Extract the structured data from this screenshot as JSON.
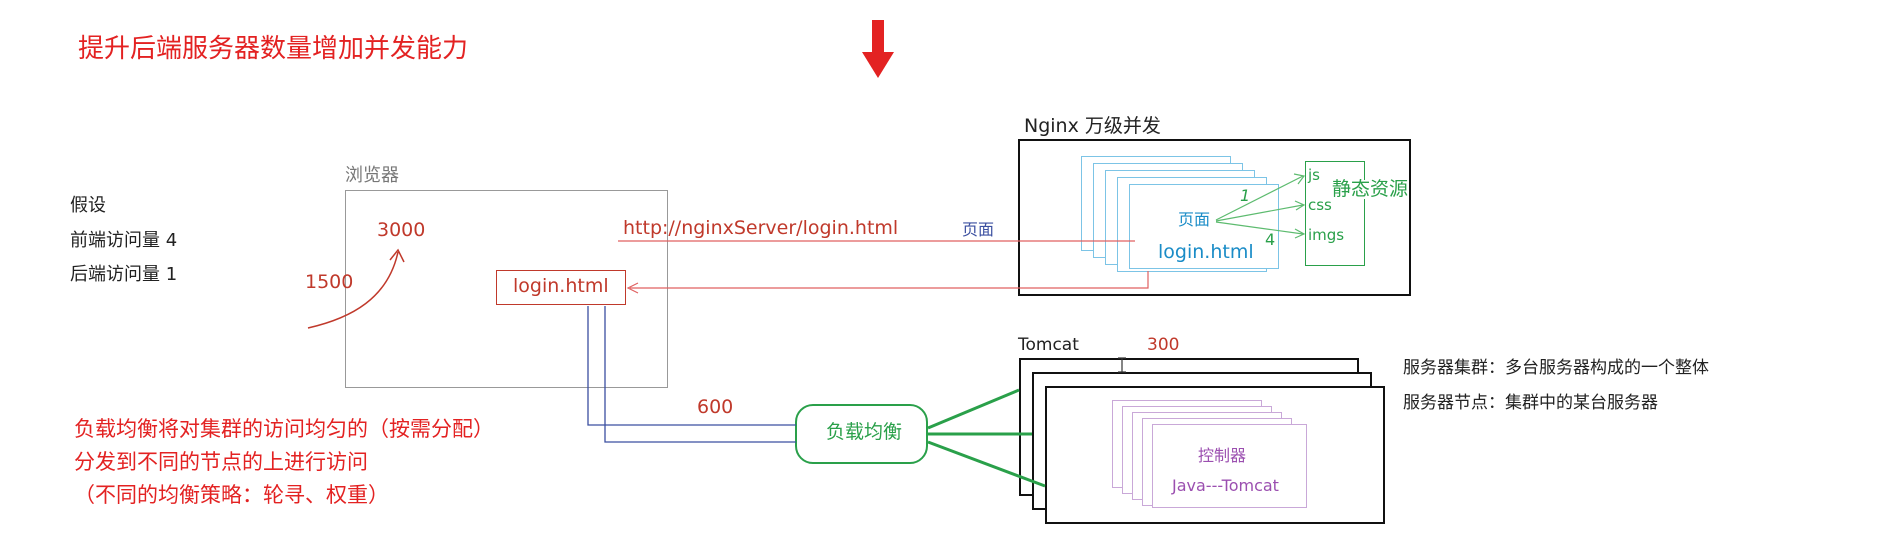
{
  "heading": "提升后端服务器数量增加并发能力",
  "assumption": {
    "title": "假设",
    "frontend": "前端访问量  4",
    "backend": "后端访问量  1"
  },
  "browser": {
    "label": "浏览器",
    "value_3000": "3000",
    "value_1500": "1500",
    "login": "login.html"
  },
  "request": {
    "url": "http://nginxServer/login.html",
    "page_label": "页面"
  },
  "nginx": {
    "title": "Nginx   万级并发",
    "page_label": "页面",
    "login": "login.html",
    "static_label": "静态资源",
    "static_items": [
      "js",
      "css",
      "imgs"
    ],
    "mark_1": "1",
    "mark_4": "4"
  },
  "load_balance": {
    "label": "负载均衡",
    "value_600": "600"
  },
  "tomcat": {
    "title": "Tomcat",
    "value_300": "300",
    "controller": "控制器",
    "java": "Java---Tomcat"
  },
  "cluster_notes": {
    "cluster": "服务器集群：多台服务器构成的一个整体",
    "node": "服务器节点：集群中的某台服务器"
  },
  "lb_notes": {
    "line1": "负载均衡将对集群的访问均匀的（按需分配）",
    "line2": "分发到不同的节点的上进行访问",
    "line3": "（不同的均衡策略：轮寻、权重）"
  },
  "colors": {
    "red": "#e32222",
    "green": "#2aa04a",
    "cyan": "#1a8cc7",
    "purple": "#9b4fb0",
    "navy": "#3b4fa0"
  }
}
